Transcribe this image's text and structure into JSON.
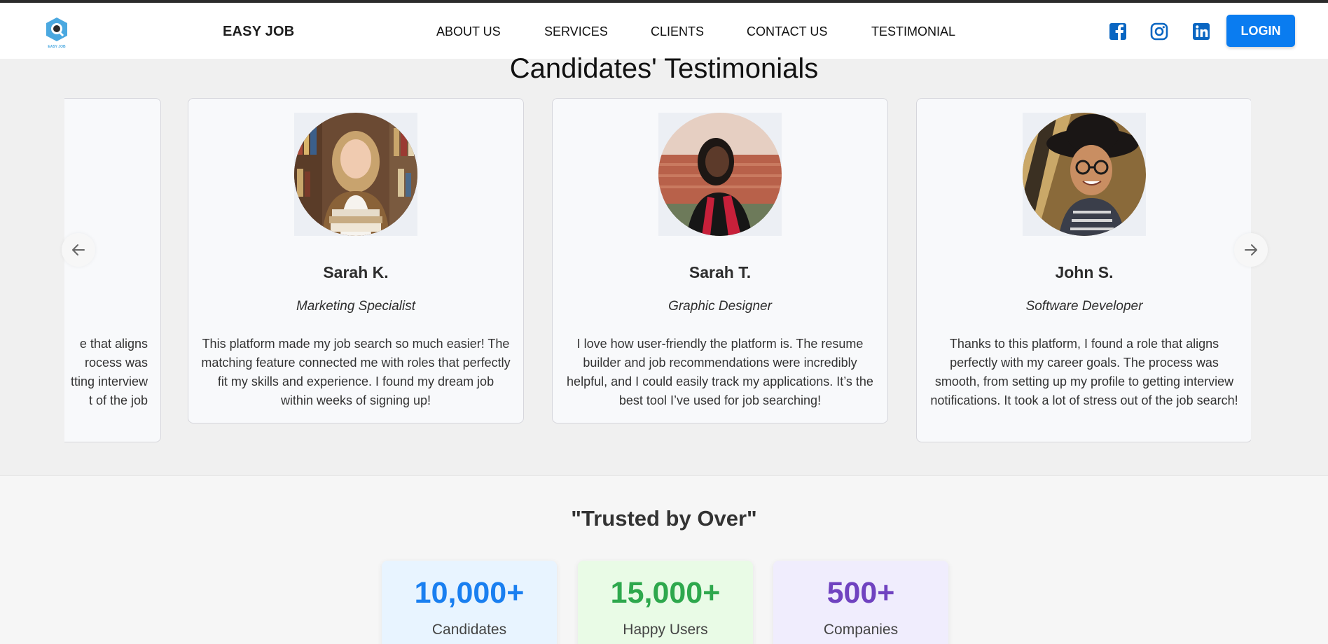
{
  "navbar": {
    "brand": "EASY JOB",
    "logo_text": "EASY JOB",
    "links": [
      {
        "label": "ABOUT US"
      },
      {
        "label": "SERVICES"
      },
      {
        "label": "CLIENTS"
      },
      {
        "label": "CONTACT US"
      },
      {
        "label": "TESTIMONIAL"
      }
    ],
    "social_icons": [
      "facebook-icon",
      "instagram-icon",
      "linkedin-icon"
    ],
    "login_label": "LOGIN"
  },
  "testimonials": {
    "title": "Candidates' Testimonials",
    "partial_card": {
      "lines": [
        "e that aligns",
        "rocess was",
        "tting interview",
        "t of the job"
      ]
    },
    "cards": [
      {
        "name": "Sarah K.",
        "role": "Marketing Specialist",
        "text": "This platform made my job search so much easier! The matching feature connected me with roles that perfectly fit my skills and experience. I found my dream job within weeks of signing up!"
      },
      {
        "name": "Sarah T.",
        "role": "Graphic Designer",
        "text": "I love how user-friendly the platform is. The resume builder and job recommendations were incredibly helpful, and I could easily track my applications. It’s the best tool I’ve used for job searching!"
      },
      {
        "name": "John S.",
        "role": "Software Developer",
        "text": "Thanks to this platform, I found a role that aligns perfectly with my career goals. The process was smooth, from setting up my profile to getting interview notifications. It took a lot of stress out of the job search!"
      }
    ],
    "prev_icon": "arrow-left-icon",
    "next_icon": "arrow-right-icon"
  },
  "trusted": {
    "title": "\"Trusted by Over\"",
    "stats": [
      {
        "value": "10,000+",
        "label": "Candidates",
        "color": "#1a7ff0",
        "bg": "#e8f4ff"
      },
      {
        "value": "15,000+",
        "label": "Happy Users",
        "color": "#2ea84d",
        "bg": "#e9fbe6"
      },
      {
        "value": "500+",
        "label": "Companies",
        "color": "#7043c0",
        "bg": "#f0edfd"
      }
    ]
  },
  "colors": {
    "accent": "#0a7cf0",
    "page_bg": "#f0f0f0",
    "card_bg": "#f8f9fb"
  }
}
